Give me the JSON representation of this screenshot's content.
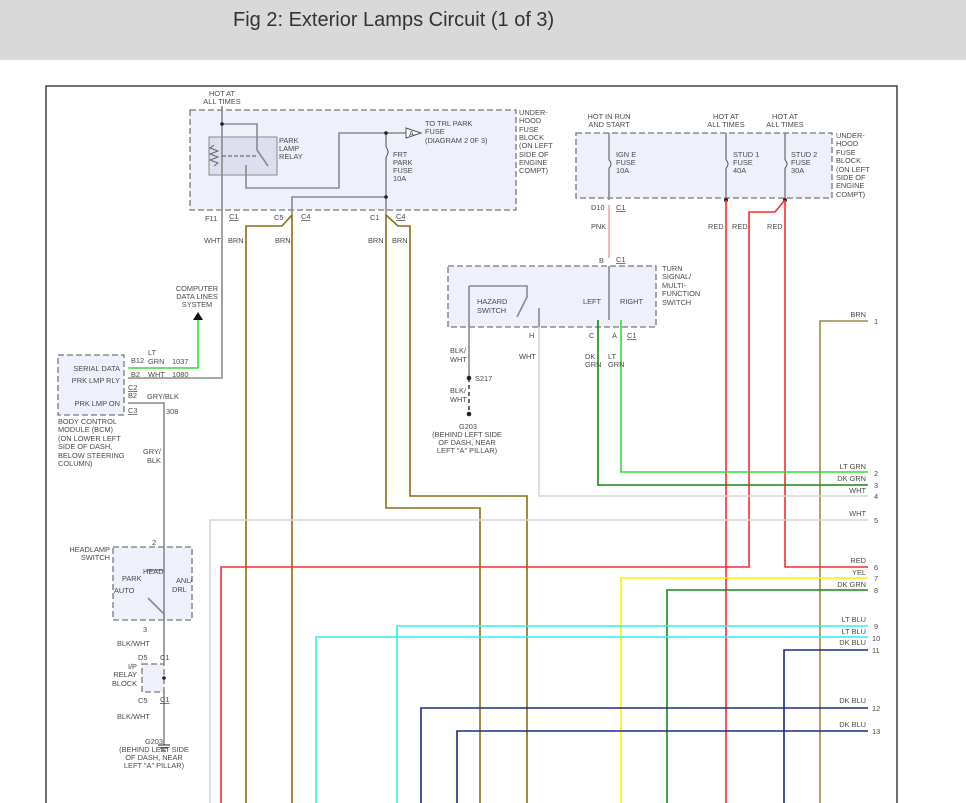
{
  "title": "Fig 2: Exterior Lamps Circuit (1 of 3)",
  "colors": {
    "brown": "#8b6d14",
    "red": "#ff2a2a",
    "pink": "#ff9aa8",
    "lt_green": "#33dd33",
    "dk_green": "#138a13",
    "yellow": "#ffee00",
    "lt_blue": "#33eeee",
    "dk_blue": "#1a2a8a",
    "white_wire": "#d6d6d6",
    "box_fill": "#eef0fb"
  },
  "left_fuse_block": {
    "hot": [
      "HOT AT",
      "ALL TIMES"
    ],
    "block_label": [
      "UNDER-",
      "HOOD",
      "FUSE",
      "BLOCK",
      "(ON LEFT",
      "SIDE OF",
      "ENGINE",
      "COMPT)"
    ],
    "relay": [
      "PARK",
      "LAMP",
      "RELAY"
    ],
    "trl": [
      "TO TRL PARK",
      "FUSE",
      "(DIAGRAM 2 0F 3)"
    ],
    "trl_connector": "A",
    "fuse": [
      "FRT",
      "PARK",
      "FUSE",
      "10A"
    ],
    "connectors": [
      "F11",
      "C1",
      "C5",
      "C4",
      "C1",
      "C4"
    ],
    "wires": [
      "WHT",
      "BRN",
      "BRN",
      "BRN",
      "BRN"
    ]
  },
  "right_fuse_block": {
    "hot1": [
      "HOT IN RUN",
      "AND START"
    ],
    "hot2": [
      "HOT AT",
      "ALL TIMES"
    ],
    "hot3": [
      "HOT AT",
      "ALL TIMES"
    ],
    "fuse1": [
      "IGN E",
      "FUSE",
      "10A"
    ],
    "fuse2": [
      "STUD 1",
      "FUSE",
      "40A"
    ],
    "fuse3": [
      "STUD 2",
      "FUSE",
      "30A"
    ],
    "block_label": [
      "UNDER-",
      "HOOD",
      "FUSE",
      "BLOCK",
      "(ON LEFT",
      "SIDE OF",
      "ENGINE",
      "COMPT)"
    ],
    "connectors": [
      "D10",
      "C1"
    ],
    "wires": [
      "PNK",
      "RED",
      "RED",
      "RED"
    ]
  },
  "turn_switch": {
    "top_connector": [
      "B",
      "C1"
    ],
    "label": [
      "TURN",
      "SIGNAL/",
      "MULTI-",
      "FUNCTION",
      "SWITCH"
    ],
    "hazard": [
      "HAZARD",
      "SWITCH"
    ],
    "left": "LEFT",
    "right": "RIGHT",
    "pins": [
      "H",
      "C",
      "A",
      "C1"
    ],
    "wires": {
      "blk_wht1": [
        "BLK/",
        "WHT"
      ],
      "splice": "S217",
      "blk_wht2": [
        "BLK/",
        "WHT"
      ],
      "wht": "WHT",
      "dk_grn": [
        "DK",
        "GRN"
      ],
      "lt_grn": [
        "LT",
        "GRN"
      ]
    },
    "ground": "G203",
    "ground_loc": [
      "(BEHIND LEFT SIDE",
      "OF DASH, NEAR",
      "LEFT \"A\" PILLAR)"
    ]
  },
  "bcm": {
    "pins": [
      "SERIAL DATA",
      "PRK LMP RLY",
      "PRK LMP ON"
    ],
    "connectors": [
      "B12",
      "B2",
      "C2",
      "B2",
      "C3"
    ],
    "wires": {
      "lt": "LT",
      "grn": "GRN",
      "c1037": "1037",
      "wht": "WHT",
      "c1080": "1080",
      "gry_blk": "GRY/BLK",
      "c308": "308",
      "gry_blk2": [
        "GRY/",
        "BLK"
      ]
    },
    "label": [
      "BODY CONTROL",
      "MODULE (BCM)",
      "(ON LOWER LEFT",
      "SIDE OF DASH,",
      "BELOW STEERING",
      "COLUMN)"
    ],
    "computer": [
      "COMPUTER",
      "DATA LINES",
      "SYSTEM"
    ]
  },
  "headlamp": {
    "label": [
      "HEADLAMP",
      "SWITCH"
    ],
    "positions": [
      "HEAD",
      "PARK",
      "AUTO",
      "ANL/",
      "DRL"
    ],
    "pins": [
      "2",
      "3"
    ],
    "wire1": "BLK/WHT",
    "relay_conn": [
      "D5",
      "C1",
      "C5",
      "C1"
    ],
    "relay_block": [
      "I/P",
      "RELAY",
      "BLOCK"
    ],
    "wire2": "BLK/WHT",
    "ground": "G203",
    "ground_loc": [
      "(BEHIND LEFT SIDE",
      "OF DASH, NEAR",
      "LEFT \"A\" PILLAR)"
    ]
  },
  "outputs": [
    {
      "color": "BRN",
      "num": "1"
    },
    {
      "color": "LT GRN",
      "num": "2"
    },
    {
      "color": "DK GRN",
      "num": "3"
    },
    {
      "color": "WHT",
      "num": "4"
    },
    {
      "color": "WHT",
      "num": "5"
    },
    {
      "color": "RED",
      "num": "6"
    },
    {
      "color": "YEL",
      "num": "7"
    },
    {
      "color": "DK GRN",
      "num": "8"
    },
    {
      "color": "LT BLU",
      "num": "9"
    },
    {
      "color": "LT BLU",
      "num": "10"
    },
    {
      "color": "DK BLU",
      "num": "11"
    },
    {
      "color": "DK BLU",
      "num": "12"
    },
    {
      "color": "DK BLU",
      "num": "13"
    }
  ]
}
